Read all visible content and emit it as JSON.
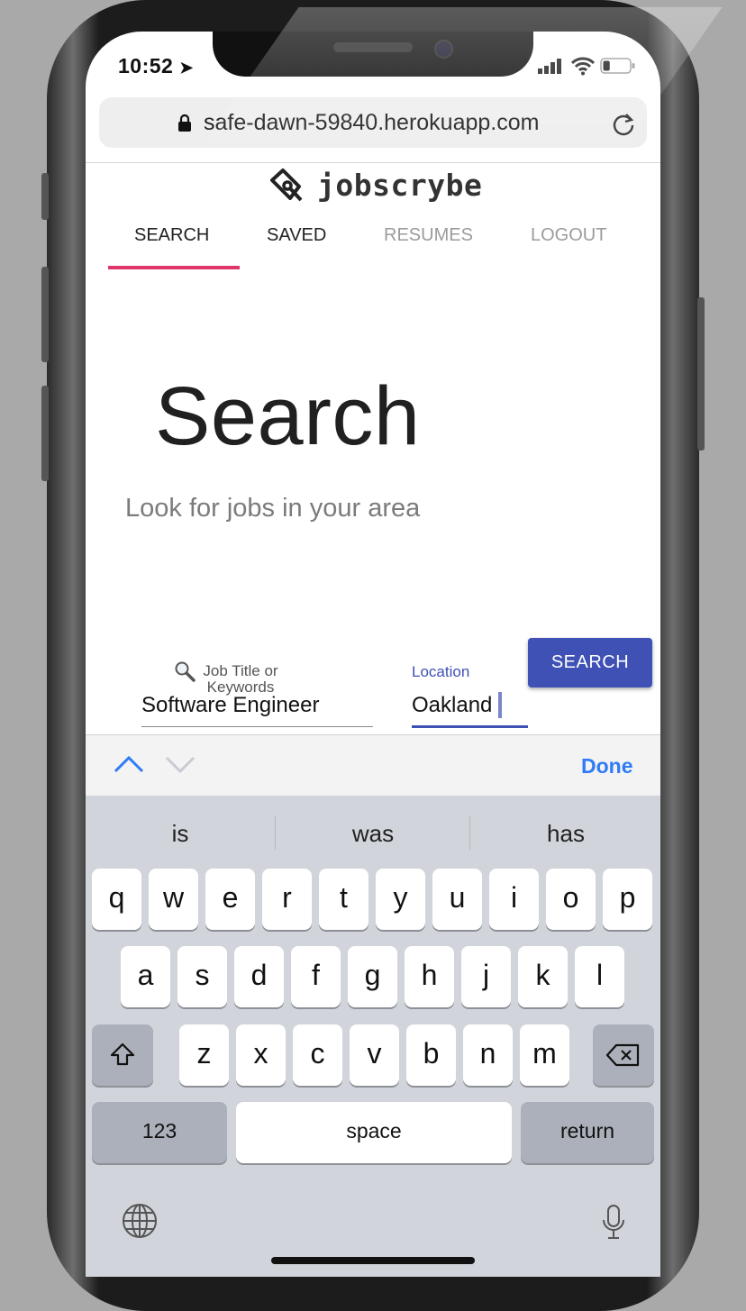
{
  "status_bar": {
    "time": "10:52",
    "battery_level": 0.25
  },
  "browser": {
    "url": "safe-dawn-59840.herokuapp.com"
  },
  "app": {
    "brand": "jobscrybe",
    "tabs": [
      {
        "label": "SEARCH",
        "active": true
      },
      {
        "label": "SAVED",
        "active": false
      },
      {
        "label": "RESUMES",
        "active": false
      },
      {
        "label": "LOGOUT",
        "active": false
      }
    ],
    "heading": "Search",
    "subheading": "Look for jobs in your area",
    "job_field": {
      "placeholder": "Job Title or Keywords",
      "value": "Software Engineer"
    },
    "location_field": {
      "label": "Location",
      "value": "Oakland"
    },
    "search_button": "SEARCH",
    "accent_color": "#3f51b5",
    "tab_indicator_color": "#e0356b"
  },
  "keyboard": {
    "done": "Done",
    "suggestions": [
      "is",
      "was",
      "has"
    ],
    "row1": [
      "q",
      "w",
      "e",
      "r",
      "t",
      "y",
      "u",
      "i",
      "o",
      "p"
    ],
    "row2": [
      "a",
      "s",
      "d",
      "f",
      "g",
      "h",
      "j",
      "k",
      "l"
    ],
    "row3": [
      "z",
      "x",
      "c",
      "v",
      "b",
      "n",
      "m"
    ],
    "numbers_key": "123",
    "space_key": "space",
    "return_key": "return"
  }
}
